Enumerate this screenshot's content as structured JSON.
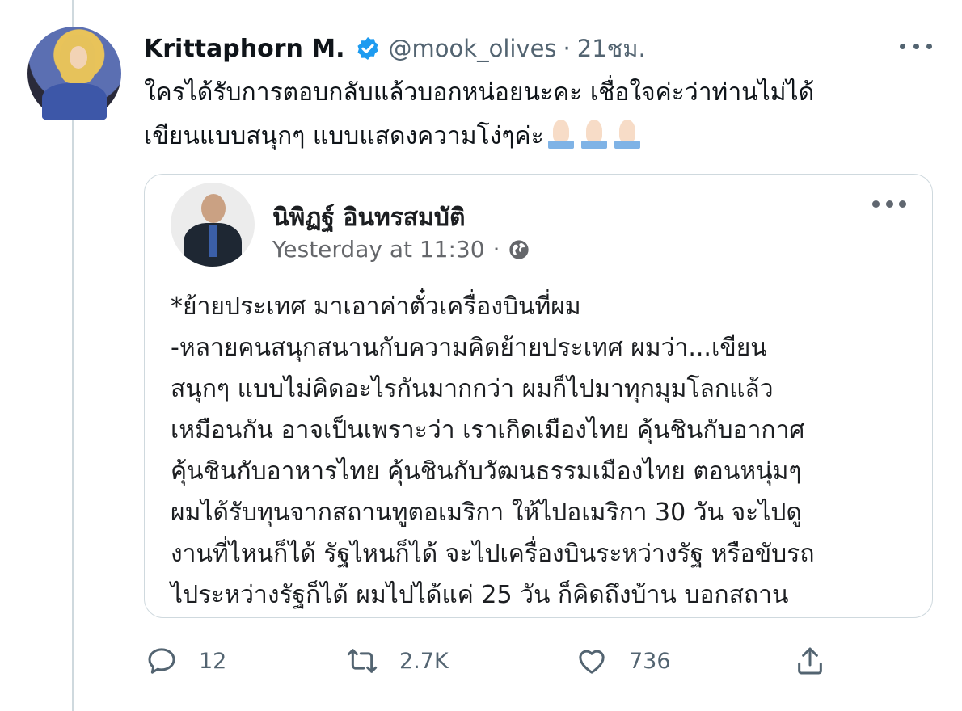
{
  "tweet": {
    "author_name": "Krittaphorn M.",
    "handle": "@mook_olives",
    "time": "21ชม.",
    "separator": "·",
    "text_line1": "ใครได้รับการตอบกลับแล้วบอกหน่อยนะคะ เชื่อใจค่ะว่าท่านไม่ได้",
    "text_line2": "เขียนแบบสนุกๆ แบบแสดงความโง่ๆค่ะ",
    "emoji": [
      "folded-hands",
      "folded-hands",
      "folded-hands"
    ]
  },
  "quoted_post": {
    "author_name": "นิพิฏฐ์ อินทรสมบัติ",
    "timestamp": "Yesterday at 11:30",
    "separator": "·",
    "audience_icon": "globe-icon",
    "body": "*ย้ายประเทศ มาเอาค่าตั๋วเครื่องบินที่ผม\n-หลายคนสนุกสนานกับความคิดย้ายประเทศ ผมว่า...เขียน\nสนุกๆ แบบไม่คิดอะไรกันมากกว่า  ผมก็ไปมาทุกมุมโลกแล้ว\nเหมือนกัน  อาจเป็นเพราะว่า เราเกิดเมืองไทย คุ้นชินกับอากาศ\nคุ้นชินกับอาหารไทย  คุ้นชินกับวัฒนธรรมเมืองไทย ตอนหนุ่มๆ\nผมได้รับทุนจากสถานทูตอเมริกา ให้ไปอเมริกา 30 วัน จะไปดู\nงานที่ไหนก็ได้ รัฐไหนก็ได้ จะไปเครื่องบินระหว่างรัฐ หรือขับรถ\nไประหว่างรัฐก็ได้ ผมไปได้แค่ 25 วัน ก็คิดถึงบ้าน บอกสถาน"
  },
  "actions": {
    "replies": "12",
    "retweets": "2.7K",
    "likes": "736"
  },
  "colors": {
    "verified": "#1d9bf0",
    "muted_text": "#536471",
    "border": "#cfd9de"
  }
}
